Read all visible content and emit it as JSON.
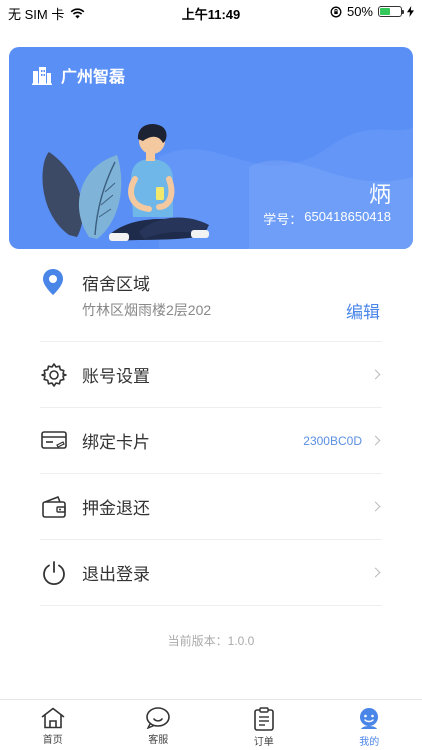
{
  "status_bar": {
    "carrier": "无 SIM 卡",
    "time": "上午11:49",
    "battery_percent": "50%",
    "battery_level": 0.5
  },
  "profile": {
    "brand": "广州智磊",
    "name": "炳",
    "student_id_label": "学号：",
    "student_id": "650418650418"
  },
  "dorm": {
    "title": "宿舍区域",
    "address": "竹林区烟雨楼2层202",
    "edit_label": "编辑"
  },
  "menu": {
    "items": [
      {
        "label": "账号设置",
        "value": "",
        "icon": "gear-icon"
      },
      {
        "label": "绑定卡片",
        "value": "2300BC0D",
        "icon": "card-icon"
      },
      {
        "label": "押金退还",
        "value": "",
        "icon": "wallet-icon"
      },
      {
        "label": "退出登录",
        "value": "",
        "icon": "power-icon"
      }
    ]
  },
  "version": "当前版本：1.0.0",
  "tabs": [
    {
      "label": "首页",
      "icon": "home-icon",
      "active": false
    },
    {
      "label": "客服",
      "icon": "chat-icon",
      "active": false
    },
    {
      "label": "订单",
      "icon": "clipboard-icon",
      "active": false
    },
    {
      "label": "我的",
      "icon": "profile-icon",
      "active": true
    }
  ],
  "colors": {
    "card_bg": "#5a8ff5",
    "accent": "#4a86e8",
    "value_text": "#5b8fe0"
  }
}
